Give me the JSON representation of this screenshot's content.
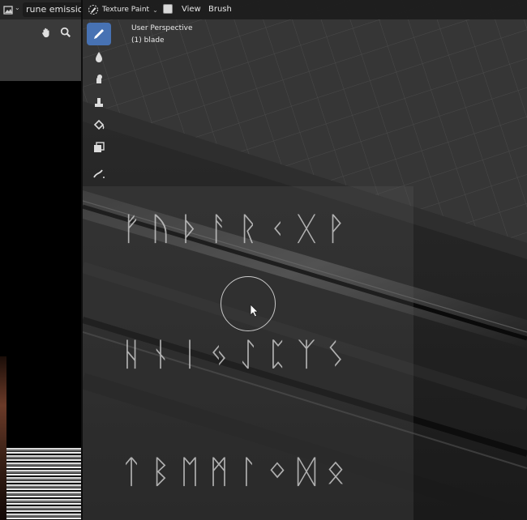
{
  "left_panel": {
    "image_name": "rune emission",
    "nav_icons": [
      "hand-pan-icon",
      "zoom-icon"
    ]
  },
  "viewport": {
    "mode": "Texture Paint",
    "menus": [
      "View",
      "Brush"
    ],
    "perspective_label": "User Perspective",
    "object_label": "(1) blade",
    "tools": [
      "draw-brush-icon",
      "soften-icon",
      "smear-icon",
      "clone-icon",
      "fill-icon",
      "mask-icon",
      "annotate-icon"
    ],
    "active_tool": "draw-brush-icon",
    "rune_rows": [
      "ᚠᚢᚦᚨᚱᚲᚷᚹ",
      "ᚺᚾᛁᛃᛇᛈᛉᛊ",
      "ᛏᛒᛖᛗᛚᛜᛞᛟ"
    ],
    "colors": {
      "accent": "#4772b3",
      "header": "#1c1c1c",
      "grid_bg": "#373737"
    }
  }
}
